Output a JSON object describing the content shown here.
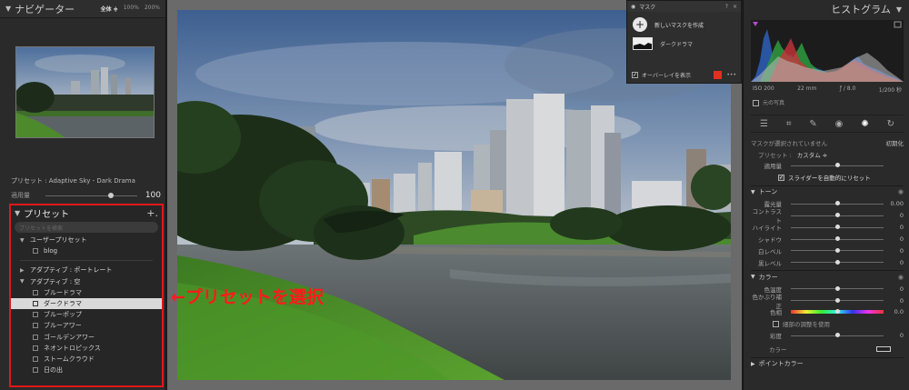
{
  "navigator": {
    "title": "ナビゲーター",
    "zoom_fit": "全体 ≑",
    "zoom_100": "100%",
    "zoom_200": "200%"
  },
  "preset_info": {
    "label": "プリセット : Adaptive Sky - Dark Drama",
    "amount_label": "適用量",
    "amount_value": "100",
    "amount_level": 0.68
  },
  "presets_panel": {
    "title": "プリセット",
    "add": "+.",
    "search_placeholder": "プリセットを検索",
    "rows": [
      {
        "type": "group",
        "glyph": "▼",
        "label": "ユーザープリセット"
      },
      {
        "type": "item",
        "label": "blog"
      },
      {
        "type": "sep"
      },
      {
        "type": "group",
        "glyph": "▶",
        "label": "アダプティブ : ポートレート"
      },
      {
        "type": "group",
        "glyph": "▼",
        "label": "アダプティブ : 空"
      },
      {
        "type": "item",
        "label": "ブルードラマ"
      },
      {
        "type": "item",
        "label": "ダークドラマ",
        "selected": true
      },
      {
        "type": "item",
        "label": "ブルーポップ"
      },
      {
        "type": "item",
        "label": "ブルーアワー"
      },
      {
        "type": "item",
        "label": "ゴールデンアワー"
      },
      {
        "type": "item",
        "label": "ネオントロピックス"
      },
      {
        "type": "item",
        "label": "ストームクラウド"
      },
      {
        "type": "item",
        "label": "日の出"
      }
    ]
  },
  "annotation": "←プリセットを選択",
  "mask": {
    "title": "マスク",
    "new_mask": "新しいマスクを作成",
    "mask_name": "ダークドラマ",
    "overlay_label": "オーバーレイを表示",
    "overlay_color": "#e0301e"
  },
  "histogram": {
    "title": "ヒストグラム",
    "iso": "ISO 200",
    "focal": "22 mm",
    "aperture": "ƒ / 8.0",
    "shutter": "1/200 秒",
    "original": "元の写真"
  },
  "develop": {
    "no_mask": "マスクが選択されていません",
    "reset": "初期化",
    "preset_label": "プリセット :",
    "preset_value": "カスタム ≑",
    "amount_label": "適用量",
    "auto_slider": "スライダーを自動的にリセット",
    "tone_title": "トーン",
    "tone": [
      {
        "name": "露光量",
        "value": "0.00"
      },
      {
        "name": "コントラスト",
        "value": "0"
      },
      {
        "name": "ハイライト",
        "value": "0"
      },
      {
        "name": "シャドウ",
        "value": "0"
      },
      {
        "name": "白レベル",
        "value": "0"
      },
      {
        "name": "黒レベル",
        "value": "0"
      }
    ],
    "color_title": "カラー",
    "color": [
      {
        "name": "色温度",
        "value": "0"
      },
      {
        "name": "色かぶり補正",
        "value": "0"
      }
    ],
    "hue_label": "色相",
    "hue_value": "0.0",
    "fine_adjust": "細部の調整を使用",
    "saturation_label": "彩度",
    "saturation_value": "0",
    "color_label": "カラー",
    "point_color_title": "ポイントカラー"
  }
}
